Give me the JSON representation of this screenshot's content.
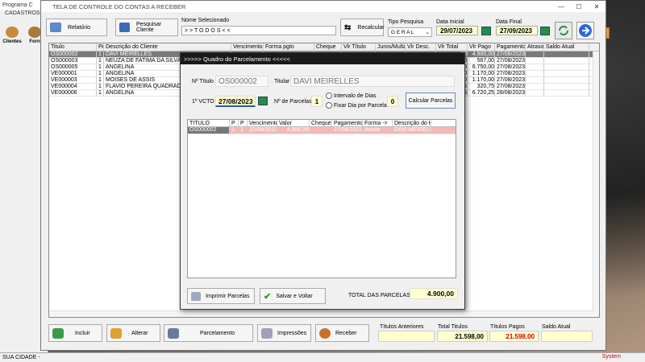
{
  "background_app": {
    "title": "Programa C",
    "menu": "CADASTROS",
    "toolbar": [
      {
        "label": "Clientes"
      },
      {
        "label": "Forn"
      }
    ],
    "status_left": "SUA CIDADE - ",
    "status_right": "System"
  },
  "window": {
    "title": "TELA DE CONTROLE DO CONTAS A RECEBER",
    "controls": [
      "—",
      "☐",
      "✕"
    ]
  },
  "header": {
    "relatorio_label": "Relatório",
    "pesquisar_cliente_label": "Pesquisar Cliente",
    "nome_selecionado_label": "Nome Selecionado",
    "nome_selecionado_value": "> > T O D O S < <",
    "recalcular_label": "Recalcular",
    "tipo_pesquisa_label": "Tipo Pesquisa",
    "tipo_pesquisa_value": "G E R A L",
    "data_inicial_label": "Data Inicial",
    "data_inicial_value": "29/07/2023",
    "data_final_label": "Data Final",
    "data_final_value": "27/09/2023"
  },
  "grid": {
    "columns": [
      "Titulo",
      "PA",
      "Descrição do Cliente",
      "Vencimento",
      "Forma pgto",
      "Cheque",
      "Vlr Título",
      "Juros/Multa",
      "Vlr Desc.",
      "Vlr Total",
      "Vlr Pago",
      "Pagamento",
      "Atraso",
      "Saldo Atual"
    ],
    "rows": [
      {
        "titulo": "OS000002",
        "pa": "1",
        "cliente": "DAVI MEIRELLES",
        "vlr_total": "00",
        "vlr_pago": "4.900,00",
        "pagamento": "27/08/2023",
        "selected": true
      },
      {
        "titulo": "OS000003",
        "pa": "1",
        "cliente": "NEUZA DE FATIMA DA SILVA",
        "vlr_total": "00",
        "vlr_pago": "567,00",
        "pagamento": "27/08/2023",
        "selected": false
      },
      {
        "titulo": "OS000005",
        "pa": "1",
        "cliente": "ANGELINA",
        "vlr_total": "00",
        "vlr_pago": "6.750,00",
        "pagamento": "27/08/2023",
        "selected": false
      },
      {
        "titulo": "VE000001",
        "pa": "1",
        "cliente": "ANGELINA",
        "vlr_total": "00",
        "vlr_pago": "1.170,00",
        "pagamento": "27/08/2023",
        "selected": false
      },
      {
        "titulo": "VE000003",
        "pa": "1",
        "cliente": "MOISES DE ASSIS",
        "vlr_total": "00",
        "vlr_pago": "1.170,00",
        "pagamento": "27/08/2023",
        "selected": false
      },
      {
        "titulo": "VE000004",
        "pa": "1",
        "cliente": "FLAVIO PEREIRA QUADRADO",
        "vlr_total": "75",
        "vlr_pago": "320,75",
        "pagamento": "27/08/2023",
        "selected": false
      },
      {
        "titulo": "VE000006",
        "pa": "1",
        "cliente": "ANGELINA",
        "vlr_total": "25",
        "vlr_pago": "6.720,25",
        "pagamento": "28/08/2023",
        "selected": false
      }
    ]
  },
  "bottom": {
    "incluir_label": "Incluir",
    "alterar_label": "Alterar",
    "parcelamento_label": "Parcelamento",
    "impressoes_label": "Impressões",
    "receber_label": "Receber",
    "titulos_anteriores_label": "Títulos Anteriores",
    "titulos_anteriores_value": "",
    "total_titulos_label": "Total Titulos",
    "total_titulos_value": "21.598,00",
    "titulos_pagos_label": "Títulos Pagos",
    "titulos_pagos_value": "21.598,00",
    "saldo_atual_label": "Saldo Atual",
    "saldo_atual_value": ""
  },
  "dialog": {
    "title": ">>>>>  Quadro do Parcelamento  <<<<<",
    "titulo_label": "Nº Título",
    "titulo_value": "OS000002",
    "titular_label": "Titular",
    "titular_value": "DAVI MEIRELLES",
    "vcto_label": "1º VCTO",
    "vcto_value": "27/08/2023",
    "parcelas_label": "Nº de Parcelas",
    "parcelas_value": "1",
    "intervalo_label": "Intervalo de Dias",
    "fixar_dia_label": "Fixar Dia por Parcela",
    "intervalo_value": "0",
    "calcular_label": "Calcular Parcelas",
    "grid_columns": [
      "TITULO",
      "P",
      "P",
      "Vencimento",
      "Valor",
      "Cheque",
      "Pagamento",
      "Forma ->",
      "Descrição do His"
    ],
    "grid_rows": [
      {
        "titulo": "OS000002",
        "p1": "1",
        "p2": "1",
        "vencimento": "27/08/2023",
        "valor": "4.900,00",
        "cheque": "",
        "pagamento": "27/08/2023",
        "forma": "Avista",
        "descricao": "DAVI MEIRELLE"
      }
    ],
    "imprimir_label": "Imprimir  Parcelas",
    "salvar_label": "Salvar e Voltar",
    "total_label": "TOTAL DAS PARCELAS",
    "total_value": "4.900,00"
  },
  "colors": {
    "selection_gray": "#7a7a7a",
    "row_pink": "#f4b8b8",
    "date_yellow": "#ffffd0",
    "red_total": "#cc0000",
    "dialog_title_bg": "#1a1a1a"
  }
}
